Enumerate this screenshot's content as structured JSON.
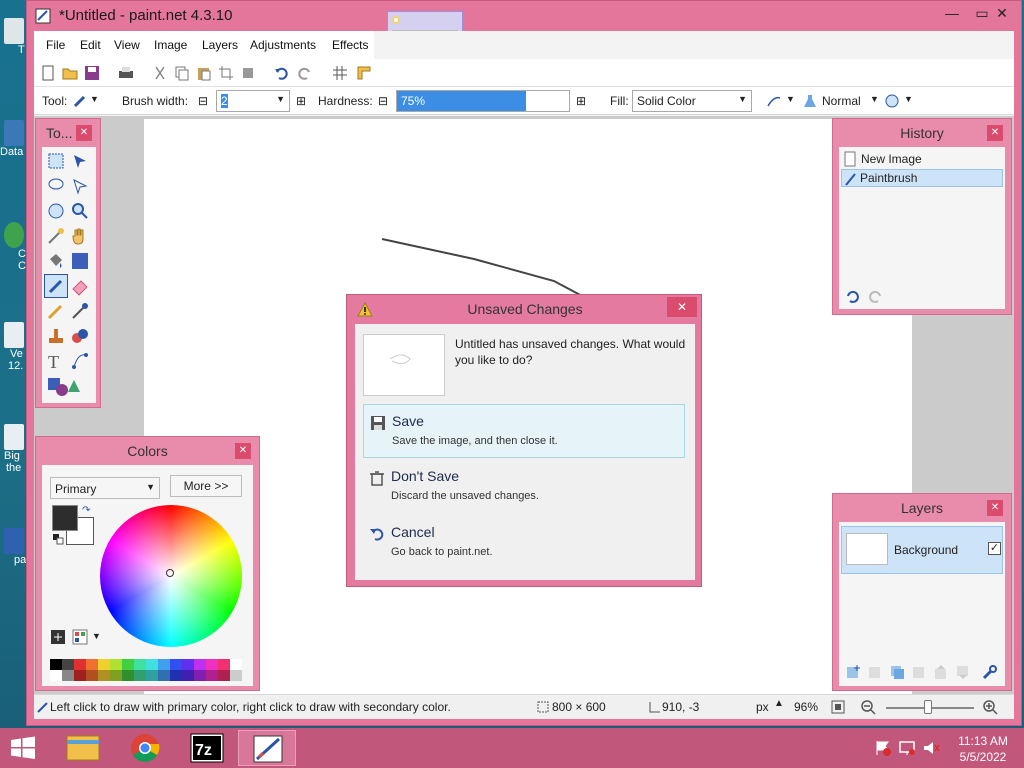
{
  "window": {
    "title": "*Untitled - paint.net 4.3.10"
  },
  "menu": [
    "File",
    "Edit",
    "View",
    "Image",
    "Layers",
    "Adjustments",
    "Effects"
  ],
  "toolbar": {
    "tool_label": "Tool:",
    "brush_width_label": "Brush width:",
    "brush_width_value": "2",
    "hardness_label": "Hardness:",
    "hardness_value": "75%",
    "hardness_fraction": 0.75,
    "fill_label": "Fill:",
    "fill_value": "Solid Color",
    "blend_mode": "Normal"
  },
  "tools_panel": {
    "title": "To..."
  },
  "colors_panel": {
    "title": "Colors",
    "select_value": "Primary",
    "more_button": "More >>"
  },
  "history_panel": {
    "title": "History",
    "items": [
      "New Image",
      "Paintbrush"
    ]
  },
  "layers_panel": {
    "title": "Layers",
    "layer_name": "Background"
  },
  "dialog": {
    "title": "Unsaved Changes",
    "message": "Untitled has unsaved changes. What would you like to do?",
    "options": [
      {
        "heading": "Save",
        "sub": "Save the image, and then close it."
      },
      {
        "heading": "Don't Save",
        "sub": "Discard the unsaved changes."
      },
      {
        "heading": "Cancel",
        "sub": "Go back to paint.net."
      }
    ]
  },
  "status": {
    "hint": "Left click to draw with primary color, right click to draw with secondary color.",
    "image_size": "800 × 600",
    "cursor_pos": "910, -3",
    "units": "px",
    "zoom": "96%"
  },
  "taskbar": {
    "time": "11:13 AM",
    "date": "5/5/2022"
  },
  "desktop_icons": [
    "T",
    "Data",
    "C",
    "C",
    "Ve",
    "12.",
    "Big",
    "the",
    "pa"
  ],
  "colors": {
    "accent": "#e4769c",
    "panel": "#e98bab",
    "selection": "#cde3f7",
    "hardness_bar": "#3b8ee3"
  }
}
